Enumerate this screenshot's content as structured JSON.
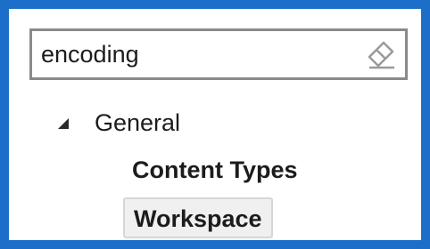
{
  "search": {
    "value": "encoding",
    "clear_icon": "eraser-icon"
  },
  "tree": {
    "category": {
      "label": "General",
      "expanded": true,
      "icon": "collapse-triangle-icon"
    },
    "items": [
      {
        "label": "Content Types",
        "selected": false
      },
      {
        "label": "Workspace",
        "selected": true
      }
    ]
  },
  "colors": {
    "frame_border": "#1b6fc8",
    "selection_bg": "#f0f0f0"
  }
}
